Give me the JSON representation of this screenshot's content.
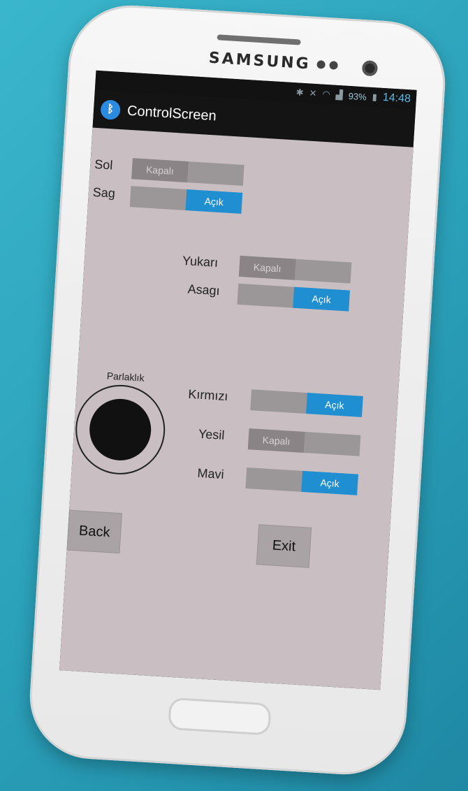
{
  "device": {
    "brand": "SAMSUNG"
  },
  "status_bar": {
    "battery": "93%",
    "time": "14:48"
  },
  "app": {
    "title": "ControlScreen"
  },
  "controls": {
    "sol": {
      "label": "Sol",
      "state": "Kapalı"
    },
    "sag": {
      "label": "Sag",
      "state": "Açık"
    },
    "yukari": {
      "label": "Yukarı",
      "state": "Kapalı"
    },
    "asagi": {
      "label": "Asagı",
      "state": "Açık"
    },
    "kirmizi": {
      "label": "Kırmızı",
      "state": "Açık"
    },
    "yesil": {
      "label": "Yesil",
      "state": "Kapalı"
    },
    "mavi": {
      "label": "Mavi",
      "state": "Açık"
    }
  },
  "brightness": {
    "label": "Parlaklık"
  },
  "buttons": {
    "back": "Back",
    "exit": "Exit"
  },
  "colors": {
    "switch_on": "#1f8fd1",
    "background": "#c9bfc3"
  }
}
